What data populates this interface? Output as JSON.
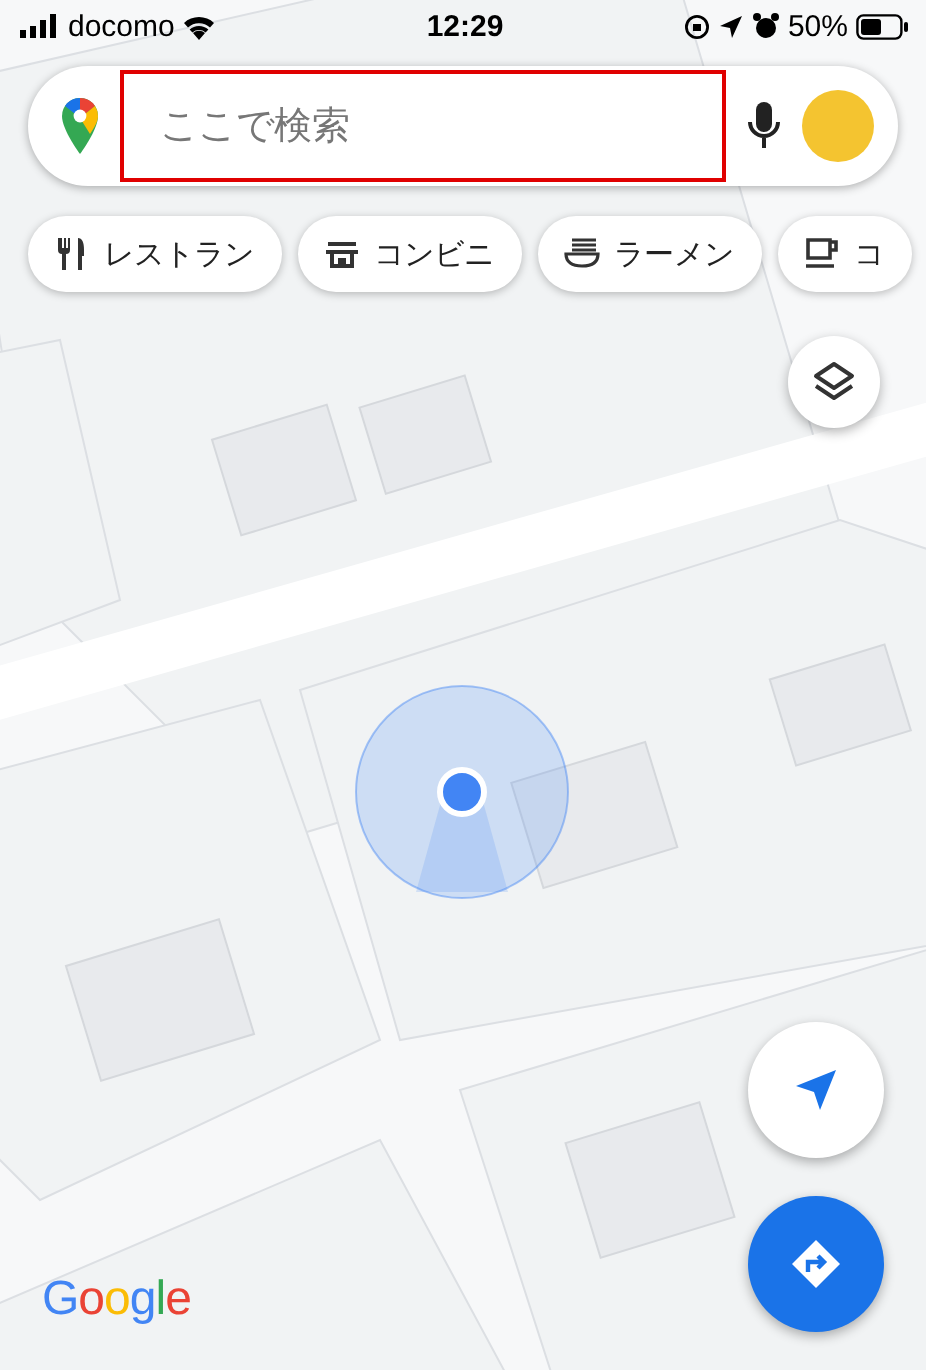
{
  "status_bar": {
    "carrier": "docomo",
    "time": "12:29",
    "battery": "50%"
  },
  "search": {
    "placeholder": "ここで検索"
  },
  "chips": [
    {
      "label": "レストラン",
      "kind": "restaurant"
    },
    {
      "label": "コンビニ",
      "kind": "store"
    },
    {
      "label": "ラーメン",
      "kind": "ramen"
    },
    {
      "label": "コ",
      "kind": "cafe"
    }
  ],
  "logo": "Google"
}
